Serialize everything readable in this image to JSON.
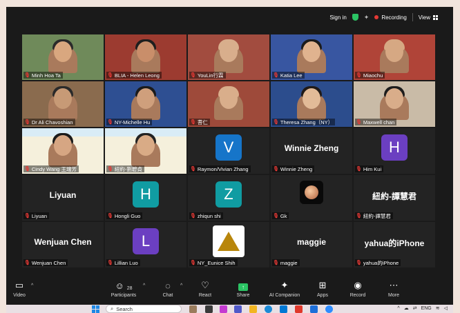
{
  "topbar": {
    "sign_in": "Sign in",
    "recording": "Recording",
    "view": "View"
  },
  "participants": [
    {
      "name": "Minh Hoa Ta",
      "type": "video",
      "bg": "#6f8a5a",
      "skin": "#d9a77f",
      "hair": "#2a2a2a"
    },
    {
      "name": "BLIA - Helen Leong",
      "type": "video",
      "bg": "#9c3b30",
      "skin": "#c98e6a",
      "hair": "#1e1e1e"
    },
    {
      "name": "YouLin行霖",
      "type": "video",
      "bg": "#a24c3f",
      "skin": "#d8ae8c",
      "hair": "#d8ae8c"
    },
    {
      "name": "Katia Lee",
      "type": "video",
      "bg": "#3856a1",
      "skin": "#e0b38f",
      "hair": "#1b1b1b"
    },
    {
      "name": "Miaochu",
      "type": "video",
      "bg": "#b04438",
      "skin": "#d6a883",
      "hair": "#d6a883"
    },
    {
      "name": "Dr Ali Chavoshian",
      "type": "video",
      "bg": "#8a6b4e",
      "skin": "#c79a76",
      "hair": "#2a2a2a"
    },
    {
      "name": "NY-Michelle Hu",
      "type": "video",
      "bg": "#2e4f92",
      "skin": "#cf9f7c",
      "hair": "#1b1b1b"
    },
    {
      "name": "菩仁",
      "type": "video",
      "bg": "#9e4a3a",
      "skin": "#d9ae8b",
      "hair": "#d9ae8b"
    },
    {
      "name": "Theresa Zhang（NY）",
      "type": "video",
      "bg": "#2c4d8d",
      "skin": "#e2bb98",
      "hair": "#201a17"
    },
    {
      "name": "Maxwell chan",
      "type": "video",
      "bg": "#c9bba7",
      "skin": "#d9ad8a",
      "hair": "#1d1d1d"
    },
    {
      "name": "Cindy Wang 王瑞芳",
      "type": "banner",
      "bg": "#f5f0dc",
      "skin": "#d6a683",
      "hair": "#1a1a1a"
    },
    {
      "name": "紐約-劉碧貞",
      "type": "banner",
      "bg": "#f5f0dc",
      "skin": "#d9ab86",
      "hair": "#222"
    },
    {
      "name": "Raymon/Vivian Zhang",
      "type": "avatar",
      "letter": "V",
      "color": "#1675c9"
    },
    {
      "name": "Winnie Zheng",
      "type": "text",
      "big": "Winnie Zheng"
    },
    {
      "name": "Him Kui",
      "type": "avatar",
      "letter": "H",
      "color": "#6b3fc1"
    },
    {
      "name": "Liyuan",
      "type": "text",
      "big": "Liyuan"
    },
    {
      "name": "Hongli Guo",
      "type": "avatar",
      "letter": "H",
      "color": "#109ca2"
    },
    {
      "name": "zhiqun shi",
      "type": "avatar",
      "letter": "Z",
      "color": "#109ca2"
    },
    {
      "name": "Gk",
      "type": "moon"
    },
    {
      "name": "紐約-譚慧君",
      "type": "text",
      "big": "紐約-譚慧君"
    },
    {
      "name": "Wenjuan Chen",
      "type": "text",
      "big": "Wenjuan Chen"
    },
    {
      "name": "Lillian Luo",
      "type": "avatar",
      "letter": "L",
      "color": "#6b3fc1"
    },
    {
      "name": "NY_Eunice Shih",
      "type": "logo"
    },
    {
      "name": "maggie",
      "type": "text",
      "big": "maggie"
    },
    {
      "name": "yahua的iPhone",
      "type": "text",
      "big": "yahua的iPhone"
    }
  ],
  "toolbar": {
    "video": "Video",
    "participants": "Participants",
    "participants_count": "28",
    "chat": "Chat",
    "react": "React",
    "share": "Share",
    "ai_companion": "AI Companion",
    "apps": "Apps",
    "record": "Record",
    "more": "More"
  },
  "taskbar": {
    "search_placeholder": "Search",
    "language": "ENG"
  },
  "colors": {
    "accent_green": "#2bc464",
    "recording_red": "#e53935",
    "meeting_bg": "#1a1a1a"
  }
}
